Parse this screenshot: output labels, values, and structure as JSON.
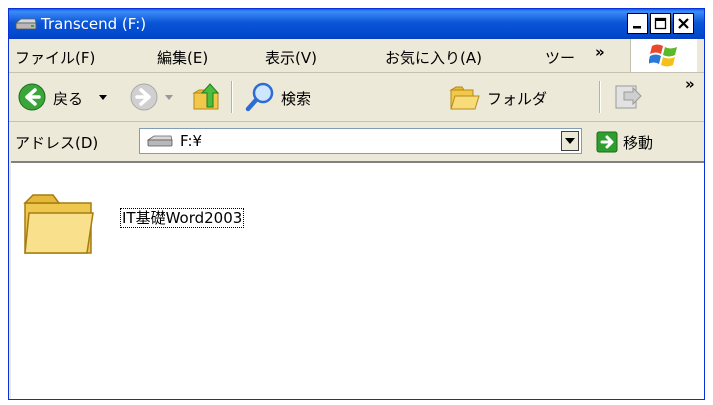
{
  "window": {
    "title": "Transcend (F:)"
  },
  "menubar": {
    "items": [
      "ファイル(F)",
      "編集(E)",
      "表示(V)",
      "お気に入り(A)",
      "ツー"
    ],
    "more": "»"
  },
  "toolbar": {
    "back_label": "戻る",
    "search_label": "検索",
    "folders_label": "フォルダ",
    "more": "»"
  },
  "address": {
    "label": "アドレス(D)",
    "value": "F:¥",
    "go_label": "移動"
  },
  "content": {
    "items": [
      {
        "name": "IT基礎Word2003",
        "type": "folder"
      }
    ]
  },
  "icons": {
    "drive": "removable-drive-icon",
    "back": "back-arrow-icon",
    "forward": "forward-arrow-icon",
    "up": "up-folder-icon",
    "search": "search-magnifier-icon",
    "folders": "folders-icon",
    "move": "move-to-icon",
    "go": "go-arrow-icon",
    "windows": "windows-logo-icon"
  },
  "colors": {
    "titlebar": "#0a5ee8",
    "chrome": "#ece9d8",
    "go": "#2e9e2e",
    "back": "#2e9e2e"
  }
}
